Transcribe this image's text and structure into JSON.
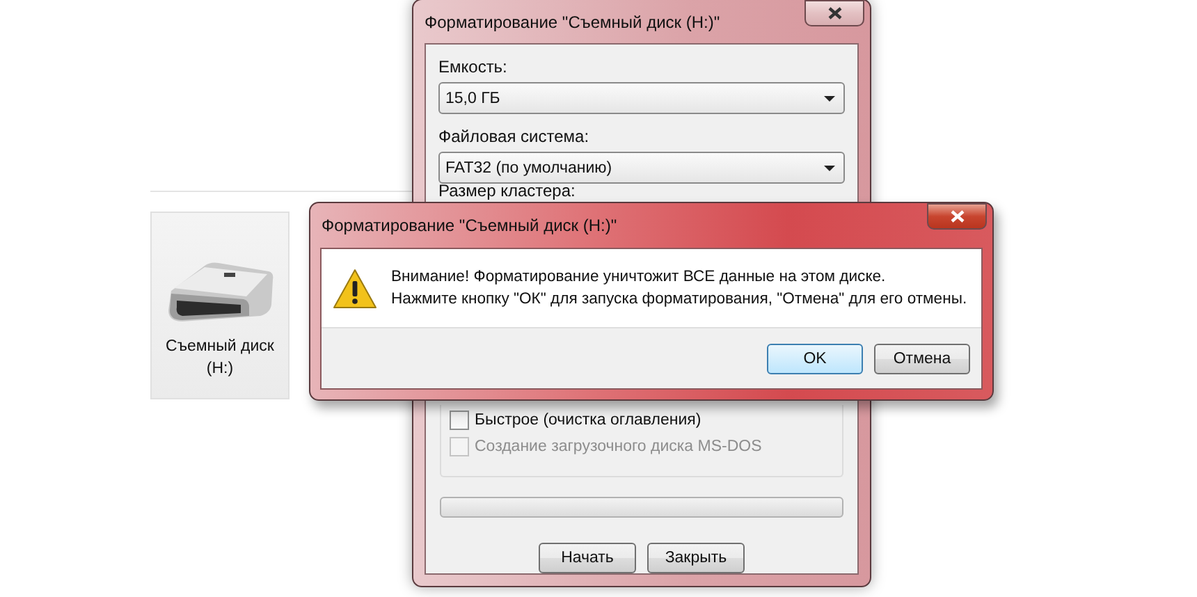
{
  "drive_tile": {
    "label": "Съемный диск (H:)"
  },
  "format_window": {
    "title": "Форматирование \"Съемный диск (H:)\"",
    "fields": [
      {
        "label": "Емкость:",
        "value": "15,0 ГБ"
      },
      {
        "label": "Файловая система:",
        "value": "FAT32 (по умолчанию)"
      }
    ],
    "cluster_label": "Размер кластера:",
    "options": [
      {
        "label": "Быстрое (очистка оглавления)",
        "checked": false,
        "disabled": false
      },
      {
        "label": "Создание загрузочного диска MS-DOS",
        "checked": false,
        "disabled": true
      }
    ],
    "progress": {
      "level": 0
    },
    "buttons": [
      "Начать",
      "Закрыть"
    ]
  },
  "alert": {
    "title": "Форматирование \"Съемный диск (H:)\"",
    "lines": [
      "Внимание! Форматирование уничтожит ВСЕ данные на этом диске.",
      "Нажмите кнопку \"ОК\" для запуска форматирования, \"Отмена\" для его отмены."
    ],
    "buttons": [
      {
        "label": "OK",
        "default": true
      },
      {
        "label": "Отмена",
        "default": false
      }
    ]
  }
}
